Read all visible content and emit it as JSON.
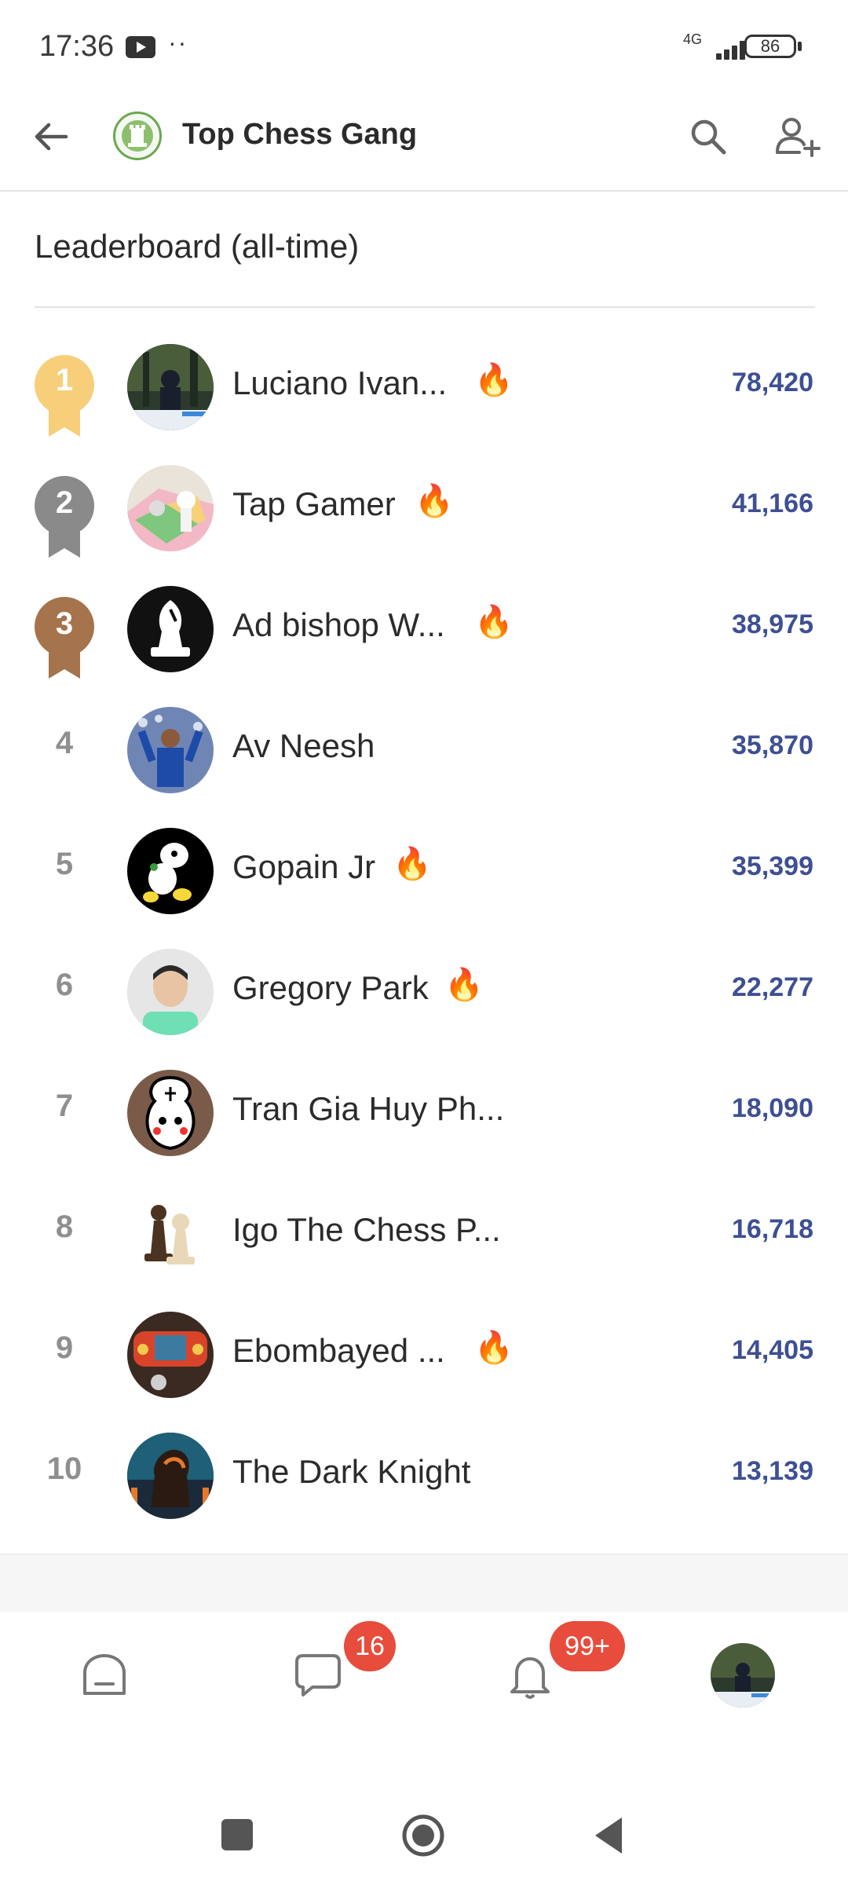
{
  "status_bar": {
    "time": "17:36",
    "network": "4G",
    "battery": "86"
  },
  "header": {
    "title": "Top Chess Gang"
  },
  "leaderboard": {
    "title": "Leaderboard (all-time)",
    "rows": [
      {
        "rank": "1",
        "name": "Luciano Ivan...",
        "score": "78,420",
        "fire": true,
        "medal_color": "#f7cf7a"
      },
      {
        "rank": "2",
        "name": "Tap Gamer",
        "score": "41,166",
        "fire": true,
        "medal_color": "#8a8a8a"
      },
      {
        "rank": "3",
        "name": "Ad bishop W...",
        "score": "38,975",
        "fire": true,
        "medal_color": "#a5744c"
      },
      {
        "rank": "4",
        "name": "Av Neesh",
        "score": "35,870",
        "fire": false
      },
      {
        "rank": "5",
        "name": "Gopain Jr",
        "score": "35,399",
        "fire": true
      },
      {
        "rank": "6",
        "name": "Gregory Park",
        "score": "22,277",
        "fire": true
      },
      {
        "rank": "7",
        "name": "Tran Gia Huy Ph...",
        "score": "18,090",
        "fire": false
      },
      {
        "rank": "8",
        "name": "Igo The Chess P...",
        "score": "16,718",
        "fire": false
      },
      {
        "rank": "9",
        "name": "Ebombayed ...",
        "score": "14,405",
        "fire": true
      },
      {
        "rank": "10",
        "name": "The Dark Knight",
        "score": "13,139",
        "fire": false
      }
    ]
  },
  "bottom_nav": {
    "messages_badge": "16",
    "notifications_badge": "99+"
  },
  "colors": {
    "score": "#3e4f93",
    "badge": "#e74c3c",
    "gold": "#f7cf7a",
    "silver": "#8a8a8a",
    "bronze": "#a5744c"
  }
}
